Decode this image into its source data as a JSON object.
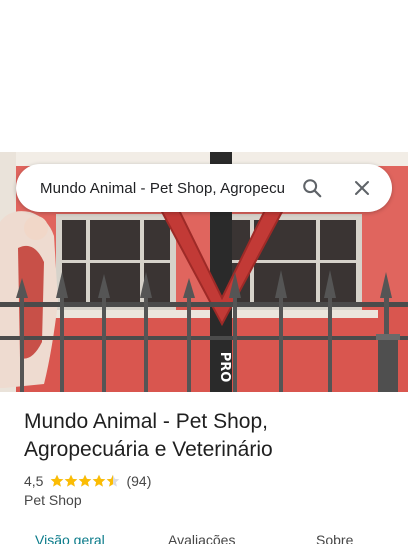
{
  "search": {
    "query": "Mundo Animal - Pet Shop, Agropecu"
  },
  "place": {
    "name": "Mundo Animal - Pet Shop, Agropecuária e Veterinário",
    "rating": "4,5",
    "stars": 4.5,
    "review_count": "(94)",
    "category": "Pet Shop"
  },
  "tabs": [
    {
      "label": "Visão geral",
      "active": true
    },
    {
      "label": "Avaliações",
      "active": false
    },
    {
      "label": "Sobre",
      "active": false
    }
  ],
  "colors": {
    "star": "#fbbc04",
    "active_tab": "#0b7b8a",
    "wall": "#e0655e"
  },
  "icons": {
    "search": "search-icon",
    "close": "close-icon"
  }
}
